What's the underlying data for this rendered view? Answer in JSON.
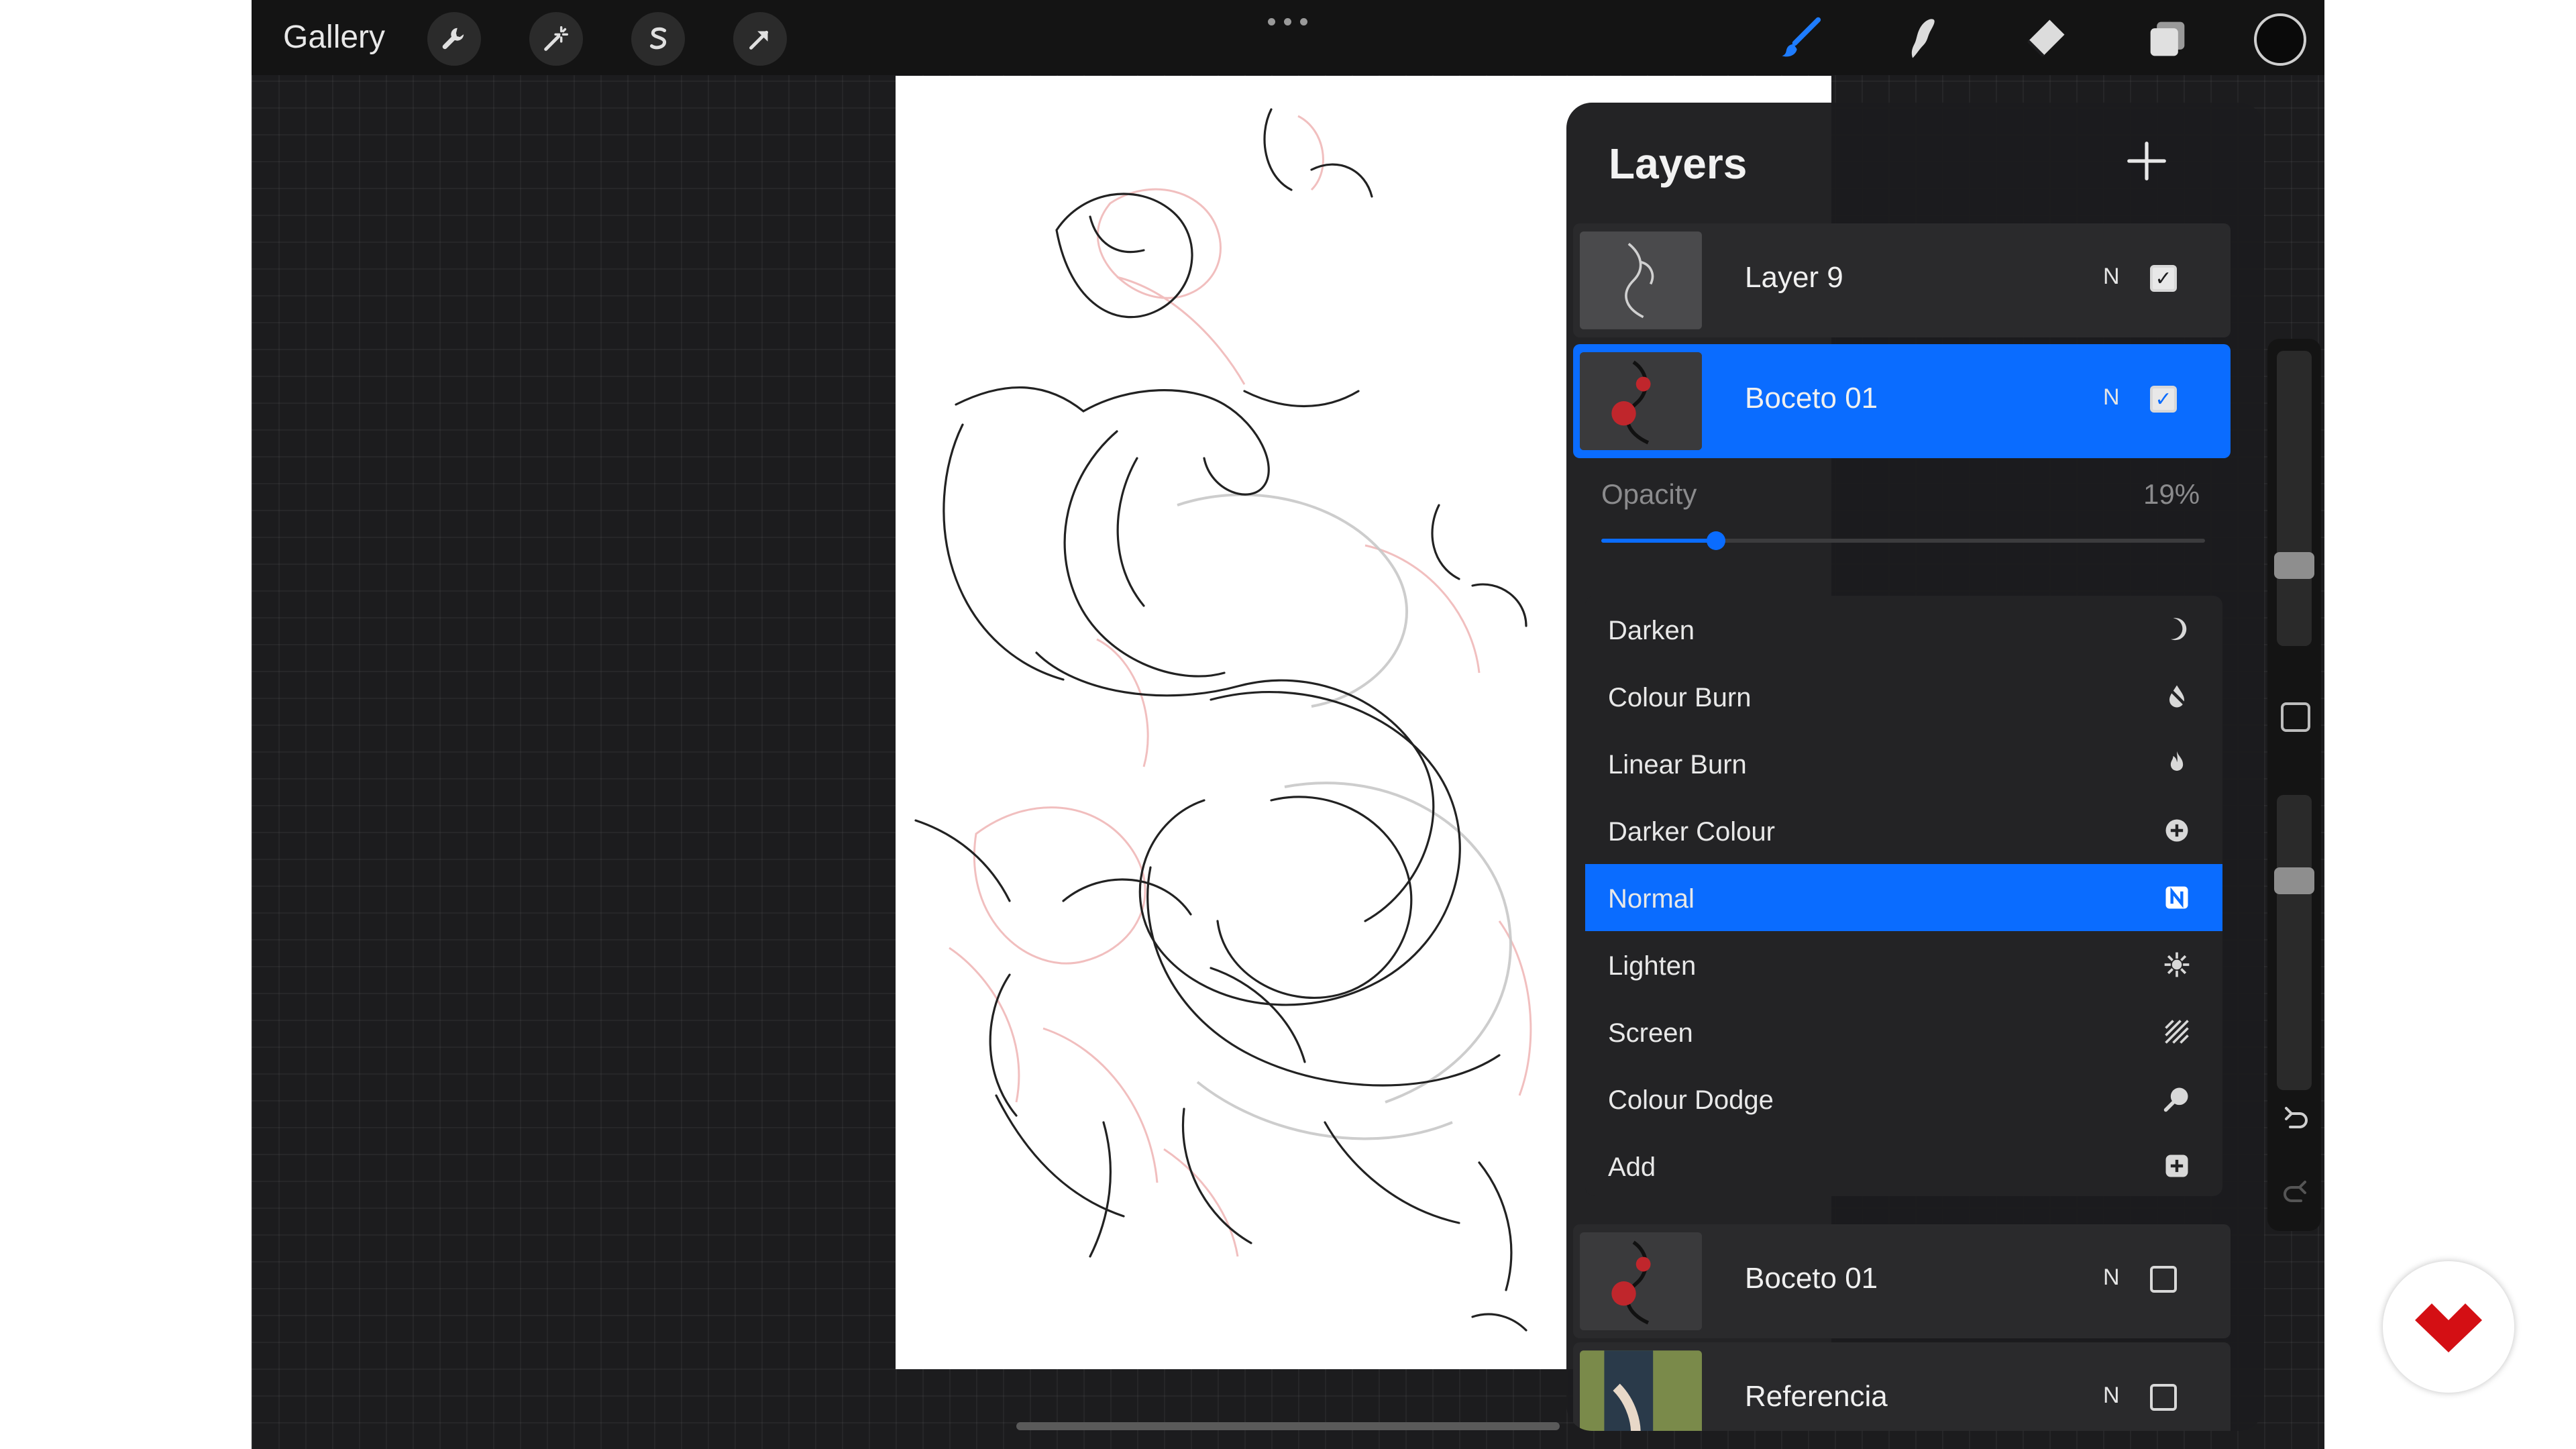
{
  "topbar": {
    "gallery_label": "Gallery",
    "left_tools": [
      {
        "name": "wrench-icon",
        "label": "Actions"
      },
      {
        "name": "magic-wand-icon",
        "label": "Adjustments"
      },
      {
        "name": "selection-s-icon",
        "label": "Selection"
      },
      {
        "name": "transform-arrow-icon",
        "label": "Transform"
      }
    ],
    "right_tools": [
      {
        "name": "brush-icon",
        "active": true
      },
      {
        "name": "smudge-icon",
        "active": false
      },
      {
        "name": "eraser-icon",
        "active": false
      },
      {
        "name": "layers-icon",
        "active": false
      }
    ],
    "current_color": "#0a0a0a",
    "accent": "#0a6cff"
  },
  "layers_panel": {
    "title": "Layers",
    "add_icon": "plus-icon",
    "layers": [
      {
        "name": "Layer 9",
        "blend": "N",
        "visible": true,
        "active": false
      },
      {
        "name": "Boceto 01",
        "blend": "N",
        "visible": true,
        "active": true
      },
      {
        "name": "Boceto 01",
        "blend": "N",
        "visible": false,
        "active": false
      },
      {
        "name": "Referencia",
        "blend": "N",
        "visible": false,
        "active": false
      }
    ],
    "opacity": {
      "label": "Opacity",
      "value_text": "19%",
      "value": 0.19
    },
    "blend_modes": [
      {
        "label": "Darken",
        "icon": "moon-icon",
        "selected": false
      },
      {
        "label": "Colour Burn",
        "icon": "burn-drop-icon",
        "selected": false
      },
      {
        "label": "Linear Burn",
        "icon": "flame-icon",
        "selected": false
      },
      {
        "label": "Darker Colour",
        "icon": "plus-circle-icon",
        "selected": false
      },
      {
        "label": "Normal",
        "icon": "n-badge-icon",
        "selected": true
      },
      {
        "label": "Lighten",
        "icon": "sunburst-icon",
        "selected": false
      },
      {
        "label": "Screen",
        "icon": "hatch-icon",
        "selected": false
      },
      {
        "label": "Colour Dodge",
        "icon": "magnifier-icon",
        "selected": false
      },
      {
        "label": "Add",
        "icon": "plus-square-icon",
        "selected": false
      }
    ]
  },
  "sidebar": {
    "brush_size_level": 0.25,
    "brush_opacity_level": 0.73
  }
}
